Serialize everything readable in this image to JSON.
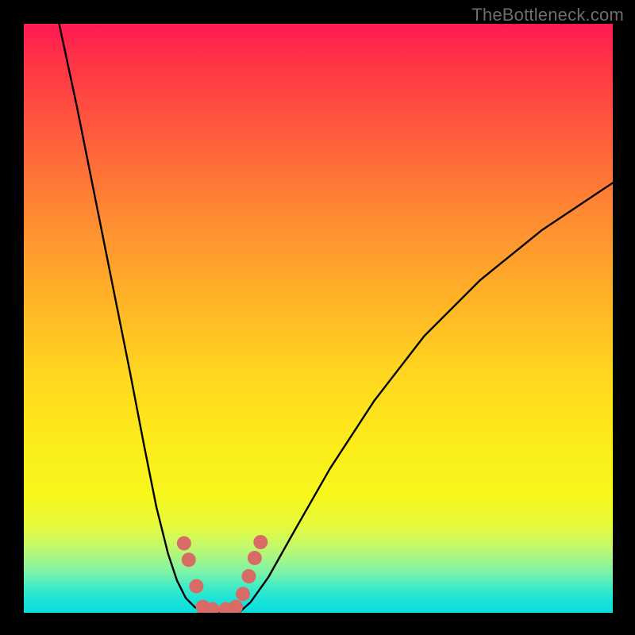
{
  "watermark": "TheBottleneck.com",
  "chart_data": {
    "type": "line",
    "title": "",
    "xlabel": "",
    "ylabel": "",
    "xlim": [
      0,
      1
    ],
    "ylim": [
      0,
      1
    ],
    "series": [
      {
        "name": "left-curve",
        "x": [
          0.06,
          0.09,
          0.12,
          0.15,
          0.18,
          0.205,
          0.225,
          0.245,
          0.26,
          0.275,
          0.29,
          0.305
        ],
        "y": [
          1.0,
          0.86,
          0.71,
          0.56,
          0.41,
          0.28,
          0.18,
          0.1,
          0.055,
          0.025,
          0.01,
          0.0
        ]
      },
      {
        "name": "valley-floor",
        "x": [
          0.305,
          0.335,
          0.365
        ],
        "y": [
          0.0,
          0.0,
          0.0
        ]
      },
      {
        "name": "right-curve",
        "x": [
          0.365,
          0.385,
          0.415,
          0.46,
          0.52,
          0.595,
          0.68,
          0.775,
          0.88,
          1.0
        ],
        "y": [
          0.0,
          0.018,
          0.06,
          0.14,
          0.245,
          0.36,
          0.47,
          0.565,
          0.65,
          0.73
        ]
      }
    ],
    "markers": {
      "name": "highlight-dots",
      "color": "#d86b66",
      "points": [
        {
          "x": 0.272,
          "y": 0.118
        },
        {
          "x": 0.28,
          "y": 0.09
        },
        {
          "x": 0.293,
          "y": 0.045
        },
        {
          "x": 0.304,
          "y": 0.01
        },
        {
          "x": 0.32,
          "y": 0.006
        },
        {
          "x": 0.343,
          "y": 0.006
        },
        {
          "x": 0.36,
          "y": 0.01
        },
        {
          "x": 0.372,
          "y": 0.032
        },
        {
          "x": 0.382,
          "y": 0.062
        },
        {
          "x": 0.392,
          "y": 0.093
        },
        {
          "x": 0.402,
          "y": 0.12
        }
      ]
    }
  }
}
